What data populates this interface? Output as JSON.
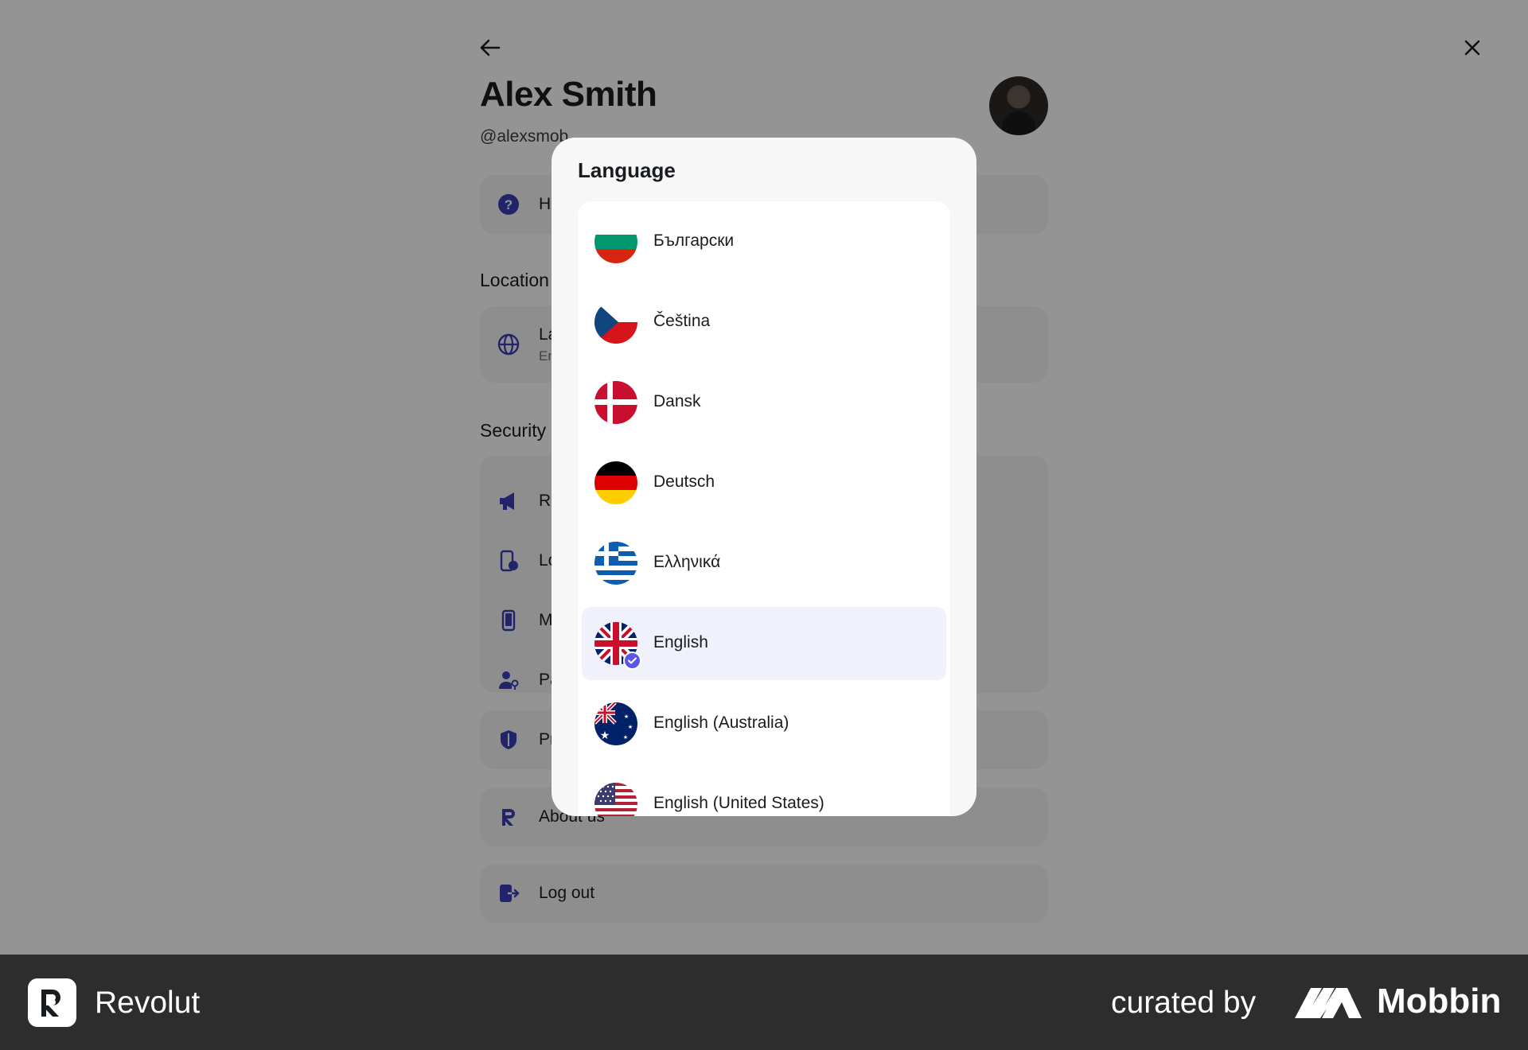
{
  "profile": {
    "name": "Alex Smith",
    "handle": "@alexsmob",
    "help_label": "H",
    "location_section": "Location",
    "language_row_label": "La",
    "language_row_value": "En",
    "security_section": "Security",
    "security_rows": [
      "Re",
      "Lo",
      "M",
      "Pa"
    ],
    "privacy_label": "Pr",
    "about_label": "About us",
    "logout_label": "Log out"
  },
  "modal": {
    "title": "Language",
    "languages": [
      {
        "name": "Български",
        "flag": "bulgaria",
        "selected": false
      },
      {
        "name": "Čeština",
        "flag": "czech",
        "selected": false
      },
      {
        "name": "Dansk",
        "flag": "denmark",
        "selected": false
      },
      {
        "name": "Deutsch",
        "flag": "germany",
        "selected": false
      },
      {
        "name": "Ελληνικά",
        "flag": "greece",
        "selected": false
      },
      {
        "name": "English",
        "flag": "uk",
        "selected": true
      },
      {
        "name": "English (Australia)",
        "flag": "australia",
        "selected": false
      },
      {
        "name": "English (United States)",
        "flag": "usa",
        "selected": false
      }
    ]
  },
  "footer": {
    "brand": "Revolut",
    "curated_by": "curated by",
    "curator": "Mobbin"
  },
  "colors": {
    "accent": "#5a57e8",
    "icon": "#3b3fb8",
    "footer_bg": "#2d2d2d"
  }
}
